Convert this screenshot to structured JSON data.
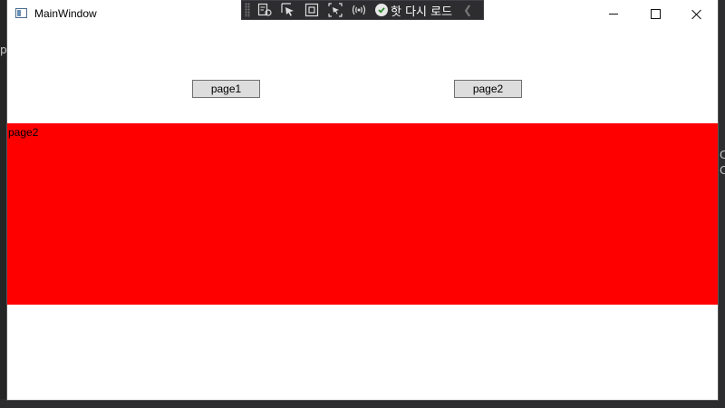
{
  "window": {
    "title": "MainWindow",
    "minimize_glyph": "minimize-icon",
    "maximize_glyph": "maximize-icon",
    "close_glyph": "close-icon"
  },
  "debug_toolbar": {
    "hot_reload_label": "핫 다시 로드",
    "icons": [
      "live-visual-tree-icon",
      "select-element-icon",
      "display-layout-adorners-icon",
      "track-focus-icon",
      "binding-failures-icon",
      "hot-reload-status-icon",
      "collapse-chevron-icon"
    ]
  },
  "content": {
    "page1_button": "page1",
    "page2_button": "page2",
    "frame_text": "page2",
    "frame_color": "#ff0000"
  },
  "background": {
    "left_char": "p",
    "right_chars": [
      "C",
      "C"
    ]
  }
}
